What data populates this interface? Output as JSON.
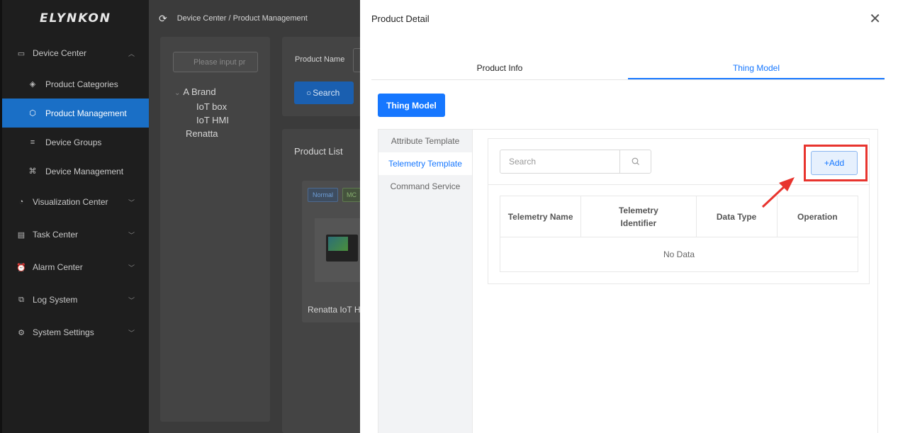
{
  "app": {
    "logo": "ELYNKON"
  },
  "sidebar": {
    "items": [
      {
        "label": "Device Center",
        "icon": "monitor-icon",
        "type": "group",
        "expanded": true
      },
      {
        "label": "Product Categories",
        "icon": "layers-icon",
        "type": "sub"
      },
      {
        "label": "Product Management",
        "icon": "cube-icon",
        "type": "sub",
        "active": true
      },
      {
        "label": "Device Groups",
        "icon": "list-icon",
        "type": "sub"
      },
      {
        "label": "Device Management",
        "icon": "hierarchy-icon",
        "type": "sub"
      },
      {
        "label": "Visualization Center",
        "icon": "visualization-icon",
        "type": "group"
      },
      {
        "label": "Task Center",
        "icon": "task-icon",
        "type": "group"
      },
      {
        "label": "Alarm Center",
        "icon": "alarm-icon",
        "type": "group"
      },
      {
        "label": "Log System",
        "icon": "log-icon",
        "type": "group"
      },
      {
        "label": "System Settings",
        "icon": "settings-icon",
        "type": "group"
      }
    ]
  },
  "header": {
    "breadcrumb": "Device Center / Product Management"
  },
  "tree": {
    "placeholder": "Please input pr",
    "nodes": [
      {
        "label": "A Brand",
        "level": 0
      },
      {
        "label": "IoT box",
        "level": 1
      },
      {
        "label": "IoT HMI",
        "level": 1
      },
      {
        "label": "Renatta",
        "level": 0
      }
    ]
  },
  "filter": {
    "product_name_label": "Product Name",
    "search_label": "Search"
  },
  "product_list": {
    "title": "Product List",
    "card": {
      "tag_normal": "Normal",
      "tag_mc": "MC",
      "name": "Renatta IoT H"
    }
  },
  "drawer": {
    "title": "Product Detail",
    "tabs": [
      {
        "label": "Product Info"
      },
      {
        "label": "Thing Model",
        "active": true
      }
    ],
    "thing_model_button": "Thing Model",
    "side_menu": [
      {
        "label": "Attribute Template"
      },
      {
        "label": "Telemetry Template",
        "active": true
      },
      {
        "label": "Command Service"
      }
    ],
    "search_placeholder": "Search",
    "add_label": "+Add",
    "table": {
      "columns": [
        "Telemetry Name",
        "Telemetry Identifier",
        "Data Type",
        "Operation"
      ],
      "empty_text": "No Data"
    }
  },
  "colors": {
    "accent": "#1677ff",
    "sidebar_active": "#1a6fc6",
    "highlight": "#e8342e"
  }
}
